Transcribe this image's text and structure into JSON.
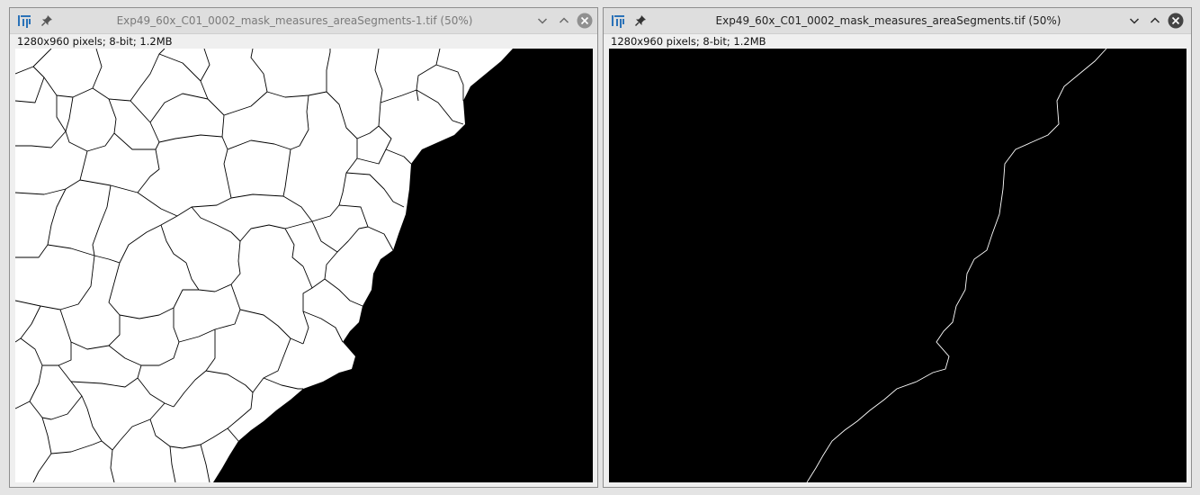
{
  "windows": [
    {
      "title": "Exp49_60x_C01_0002_mask_measures_areaSegments-1.tif (50%)",
      "info": "1280x960 pixels; 8-bit; 1.2MB",
      "focused": false
    },
    {
      "title": "Exp49_60x_C01_0002_mask_measures_areaSegments.tif (50%)",
      "info": "1280x960 pixels; 8-bit; 1.2MB",
      "focused": true
    }
  ],
  "icons": {
    "app": "imagej-icon",
    "pin": "pin-icon",
    "minimize": "chevron-down-icon",
    "maximize": "chevron-up-icon",
    "close": "close-icon"
  },
  "colors": {
    "accent": "#2a72b8",
    "close_inactive": "#909090",
    "close_active": "#444444"
  }
}
